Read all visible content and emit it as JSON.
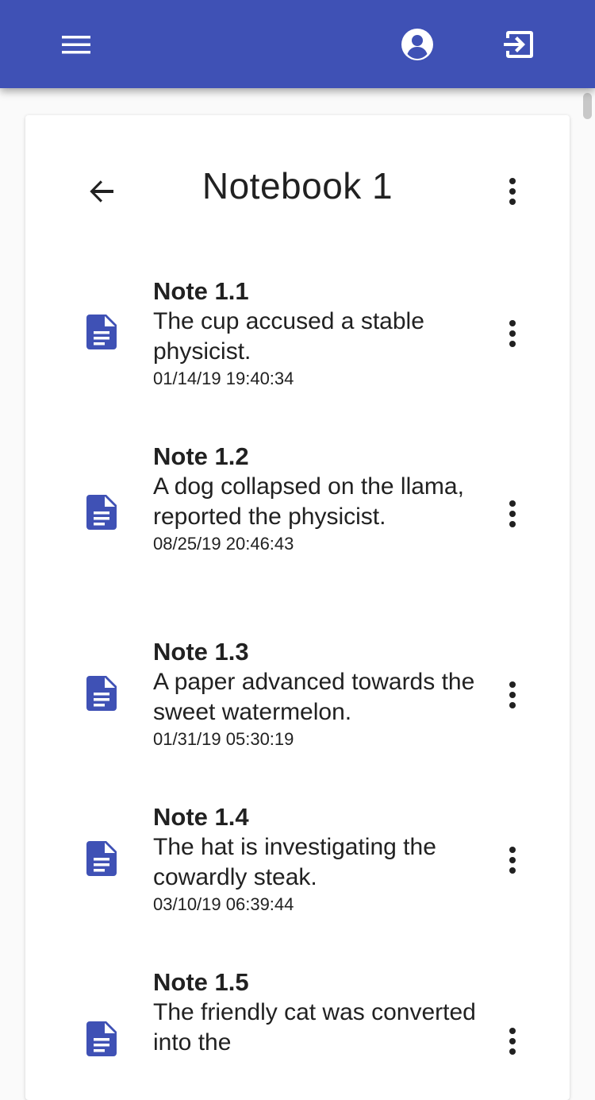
{
  "appbar": {
    "menu_icon": "hamburger-menu-icon",
    "account_icon": "account-circle-icon",
    "exit_icon": "exit-to-app-icon",
    "color": "#3f51b5"
  },
  "notebook": {
    "title": "Notebook 1",
    "back_icon": "arrow-back-icon",
    "more_icon": "more-vert-icon"
  },
  "notes": [
    {
      "title": "Note 1.1",
      "body": "The cup accused a stable physicist.",
      "date": "01/14/19 19:40:34"
    },
    {
      "title": "Note 1.2",
      "body": "A dog collapsed on the llama, reported the physicist.",
      "date": "08/25/19 20:46:43"
    },
    {
      "title": "Note 1.3",
      "body": "A paper advanced towards the sweet watermelon.",
      "date": "01/31/19 05:30:19"
    },
    {
      "title": "Note 1.4",
      "body": "The hat is investigating the cowardly steak.",
      "date": "03/10/19 06:39:44"
    },
    {
      "title": "Note 1.5",
      "body": "The friendly cat was converted into the",
      "date": ""
    }
  ],
  "colors": {
    "accent": "#3f51b5",
    "text": "#212121"
  }
}
